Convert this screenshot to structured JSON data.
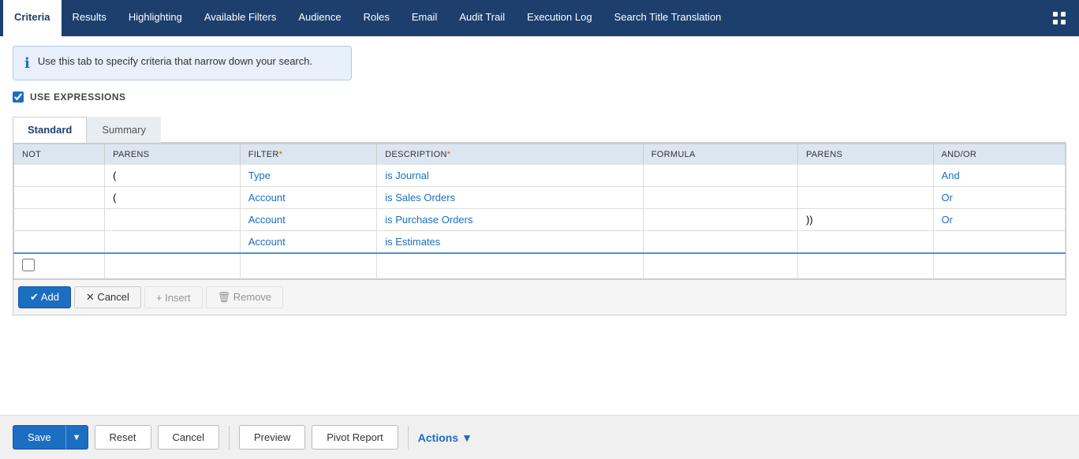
{
  "nav": {
    "items": [
      {
        "label": "Criteria",
        "active": true
      },
      {
        "label": "Results",
        "active": false
      },
      {
        "label": "Highlighting",
        "active": false
      },
      {
        "label": "Available Filters",
        "active": false
      },
      {
        "label": "Audience",
        "active": false
      },
      {
        "label": "Roles",
        "active": false
      },
      {
        "label": "Email",
        "active": false
      },
      {
        "label": "Audit Trail",
        "active": false
      },
      {
        "label": "Execution Log",
        "active": false
      },
      {
        "label": "Search Title Translation",
        "active": false
      }
    ]
  },
  "info": {
    "text": "Use this tab to specify criteria that narrow down your search."
  },
  "use_expressions": {
    "label": "USE EXPRESSIONS",
    "checked": true
  },
  "sub_tabs": [
    {
      "label": "Standard",
      "active": true
    },
    {
      "label": "Summary",
      "active": false
    }
  ],
  "table": {
    "headers": [
      {
        "label": "NOT",
        "required": false
      },
      {
        "label": "PARENS",
        "required": false
      },
      {
        "label": "FILTER",
        "required": true
      },
      {
        "label": "DESCRIPTION",
        "required": true
      },
      {
        "label": "FORMULA",
        "required": false
      },
      {
        "label": "PARENS",
        "required": false
      },
      {
        "label": "AND/OR",
        "required": false
      }
    ],
    "rows": [
      {
        "not": "",
        "parens_open": "(",
        "filter": "Type",
        "description": "is Journal",
        "formula": "",
        "parens_close": "",
        "and_or": "And"
      },
      {
        "not": "",
        "parens_open": "(",
        "filter": "Account",
        "description": "is Sales Orders",
        "formula": "",
        "parens_close": "",
        "and_or": "Or"
      },
      {
        "not": "",
        "parens_open": "",
        "filter": "Account",
        "description": "is Purchase Orders",
        "formula": "",
        "parens_close": "))",
        "and_or": "Or"
      },
      {
        "not": "",
        "parens_open": "",
        "filter": "Account",
        "description": "is Estimates",
        "formula": "",
        "parens_close": "",
        "and_or": ""
      }
    ]
  },
  "action_buttons": {
    "add": "✔ Add",
    "cancel": "✕ Cancel",
    "insert": "+ Insert",
    "remove": "🗑 Remove"
  },
  "bottom_toolbar": {
    "save": "Save",
    "reset": "Reset",
    "cancel": "Cancel",
    "preview": "Preview",
    "pivot_report": "Pivot Report",
    "actions": "Actions"
  }
}
